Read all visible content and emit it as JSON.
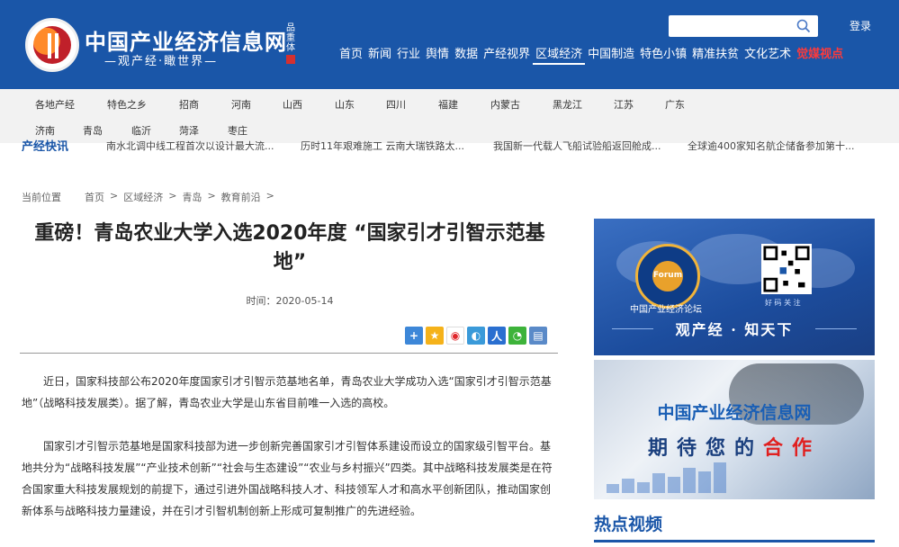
{
  "header": {
    "logo_title": "中国产业经济信息网",
    "logo_subtitle": "—观产经·瞰世界—",
    "logo_tag": "品重体",
    "search": {
      "placeholder": ""
    },
    "login_label": "登录",
    "nav": [
      {
        "label": "首页"
      },
      {
        "label": "新闻"
      },
      {
        "label": "行业"
      },
      {
        "label": "舆情"
      },
      {
        "label": "数据"
      },
      {
        "label": "产经视界"
      },
      {
        "label": "区域经济",
        "active": true
      },
      {
        "label": "中国制造"
      },
      {
        "label": "特色小镇"
      },
      {
        "label": "精准扶贫"
      },
      {
        "label": "文化艺术"
      },
      {
        "label": "觉媒视点",
        "highlight": true
      }
    ]
  },
  "subnav": {
    "row1": [
      "各地产经",
      "特色之乡",
      "招商",
      "河南",
      "山西",
      "山东",
      "四川",
      "福建",
      "内蒙古",
      "黑龙江",
      "江苏",
      "广东"
    ],
    "row2": [
      "济南",
      "青岛",
      "临沂",
      "菏泽",
      "枣庄"
    ]
  },
  "ticker": {
    "label": "产经快讯",
    "items": [
      "南水北调中线工程首次以设计最大流...",
      "历时11年艰难施工 云南大瑞铁路太...",
      "我国新一代载人飞船试验船返回舱成...",
      "全球逾400家知名航企储备参加第十..."
    ]
  },
  "breadcrumb": [
    "当前位置",
    "首页",
    ">",
    "区域经济",
    ">",
    "青岛",
    ">",
    "教育前沿",
    ">"
  ],
  "article": {
    "title": "重磅！青岛农业大学入选2020年度 “国家引才引智示范基地”",
    "time": "时间：2020-05-14",
    "paragraphs": [
      "近日，国家科技部公布2020年度国家引才引智示范基地名单，青岛农业大学成功入选“国家引才引智示范基地”（战略科技发展类）。据了解，青岛农业大学是山东省目前唯一入选的高校。",
      "国家引才引智示范基地是国家科技部为进一步创新完善国家引才引智体系建设而设立的国家级引智平台。基地共分为“战略科技发展”“产业技术创新”“社会与生态建设”“农业与乡村振兴”四类。其中战略科技发展类是在符合国家重大科技发展规划的前提下，通过引进外国战略科技人才、科技领军人才和高水平创新团队，推动国家创新体系与战略科技力量建设，并在引才引智机制创新上形成可复制推广的先进经验。"
    ],
    "share_icons": [
      "plus-share-icon",
      "qzone-icon",
      "weibo-icon",
      "tencent-weibo-icon",
      "renren-icon",
      "wechat-icon",
      "print-icon"
    ]
  },
  "sidebar": {
    "ad1": {
      "badge_text": "Forum",
      "forum_name": "中国产业经济论坛",
      "attention": "好 码 关 注",
      "slogan": "观产经 · 知天下"
    },
    "ad2": {
      "line1": "中国产业经济信息网",
      "line2_a": "期待您的",
      "line2_b": "合作"
    },
    "hot_video_title": "热点视频"
  },
  "colors": {
    "brand_blue": "#1a56a8",
    "accent_red": "#e02020",
    "subnav_bg": "#f2f2f2"
  }
}
